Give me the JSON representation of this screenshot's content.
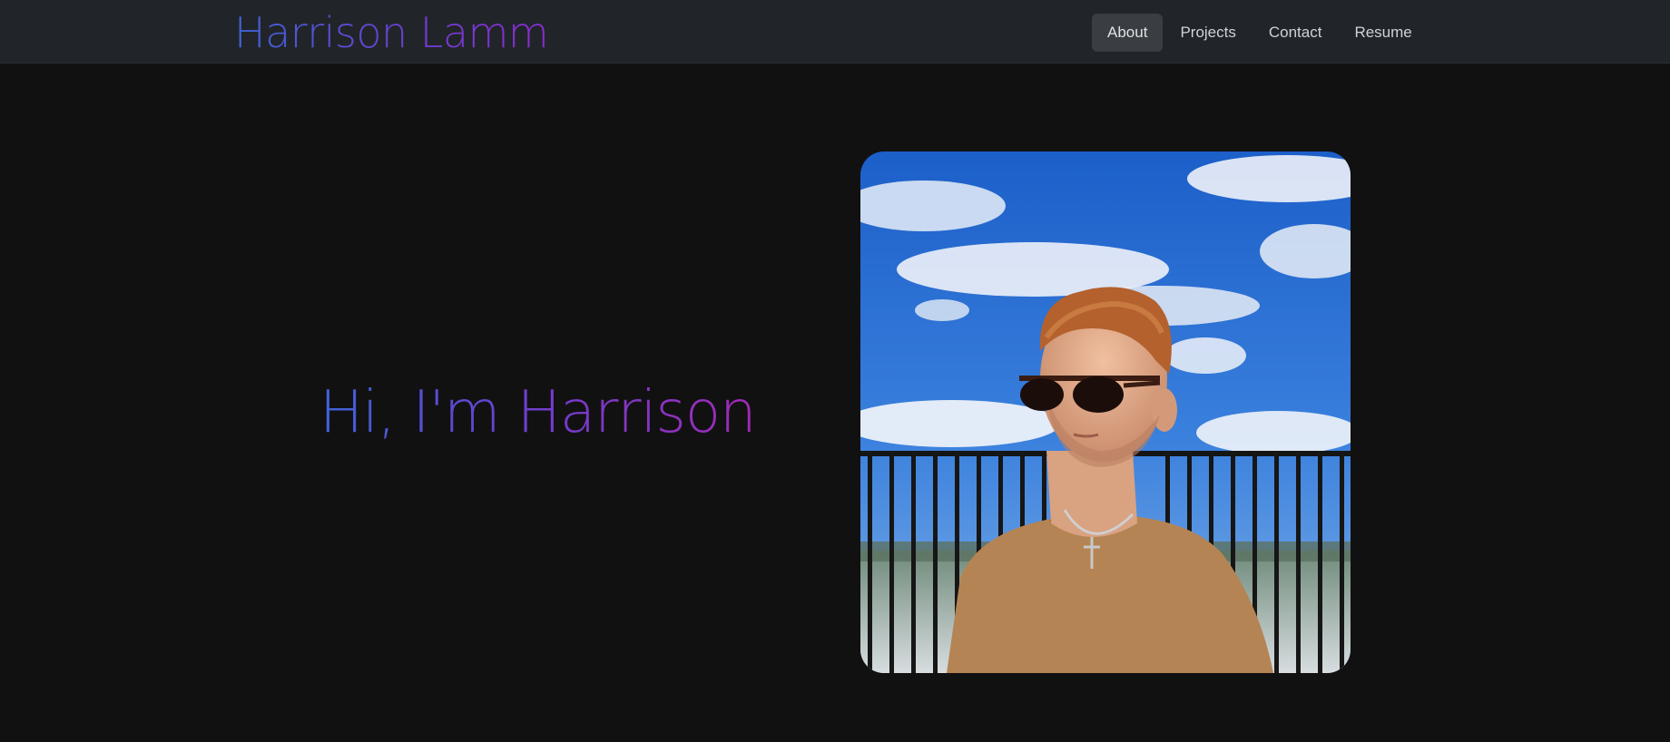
{
  "brand": {
    "name": "Harrison Lamm"
  },
  "nav": {
    "items": [
      {
        "label": "About",
        "active": true
      },
      {
        "label": "Projects",
        "active": false
      },
      {
        "label": "Contact",
        "active": false
      },
      {
        "label": "Resume",
        "active": false
      }
    ]
  },
  "hero": {
    "title": "Hi, I'm Harrison"
  },
  "colors": {
    "background": "#111112",
    "navbar": "#212529",
    "gradient_start": "#3e63d6",
    "gradient_mid": "#6a3fce",
    "gradient_end": "#a12ab6"
  }
}
